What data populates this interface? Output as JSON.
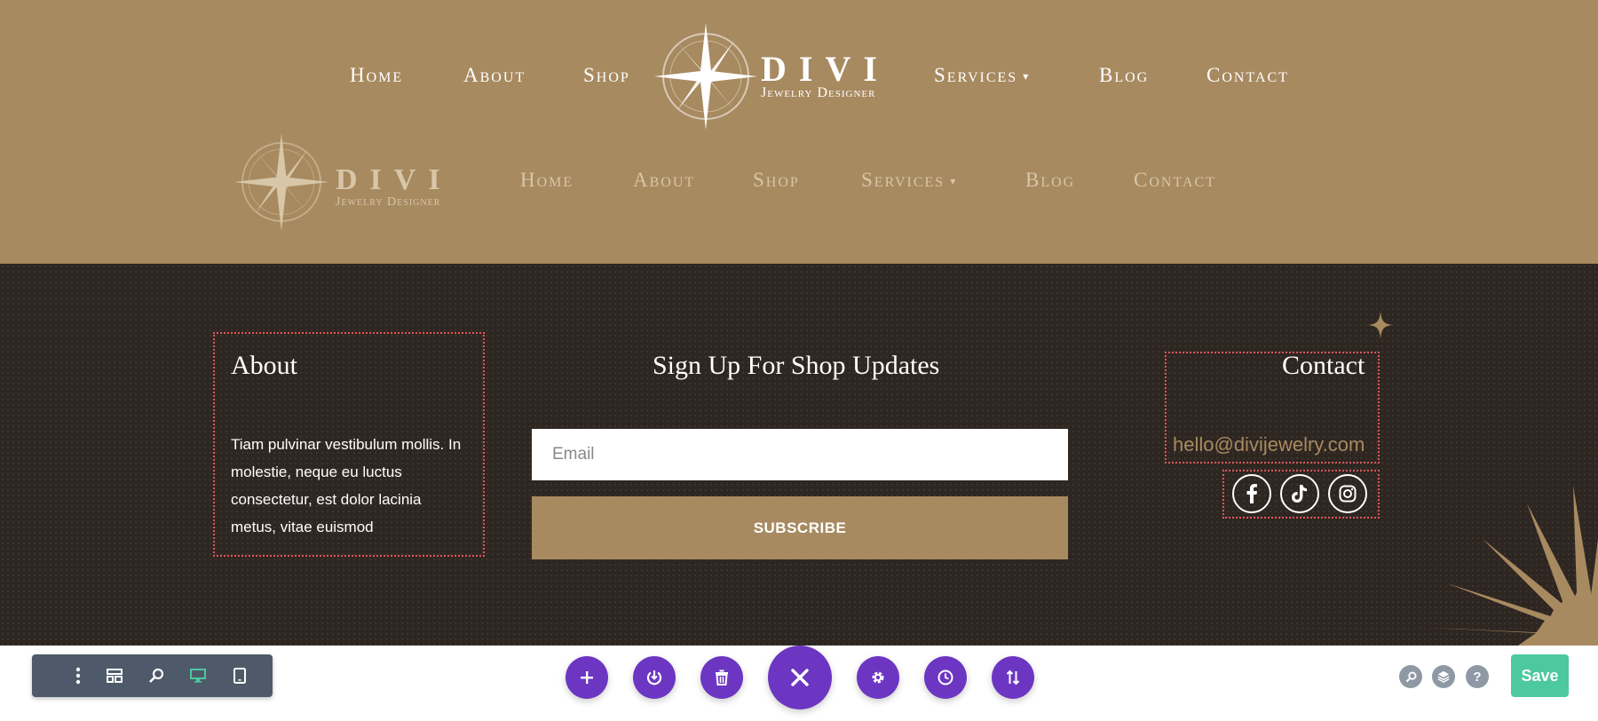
{
  "nav_primary": {
    "home": "Home",
    "about": "About",
    "shop": "Shop",
    "services": "Services",
    "blog": "Blog",
    "contact": "Contact"
  },
  "nav_sticky": {
    "home": "Home",
    "about": "About",
    "shop": "Shop",
    "services": "Services",
    "blog": "Blog",
    "contact": "Contact"
  },
  "logo": {
    "word": "DIVI",
    "tagline": "Jewelry Designer"
  },
  "footer": {
    "about": {
      "heading": "About",
      "text": "Tiam pulvinar vestibulum mollis. In molestie, neque eu luctus consectetur, est dolor lacinia metus, vitae euismod"
    },
    "signup": {
      "heading": "Sign Up For Shop Updates",
      "email_placeholder": "Email",
      "subscribe_label": "SUBSCRIBE"
    },
    "contact": {
      "heading": "Contact",
      "email": "hello@divijewelry.com"
    },
    "social_icons": [
      "facebook-icon",
      "tiktok-icon",
      "instagram-icon"
    ]
  },
  "builder": {
    "save_label": "Save"
  },
  "colors": {
    "header_bg": "#a88a60",
    "footer_bg": "#2e2621",
    "accent_gold": "#a88a60",
    "builder_purple": "#6c36c2",
    "save_green": "#4cc99e",
    "toolbar_slate": "#4e5a69",
    "outline_red": "#e0575a"
  }
}
